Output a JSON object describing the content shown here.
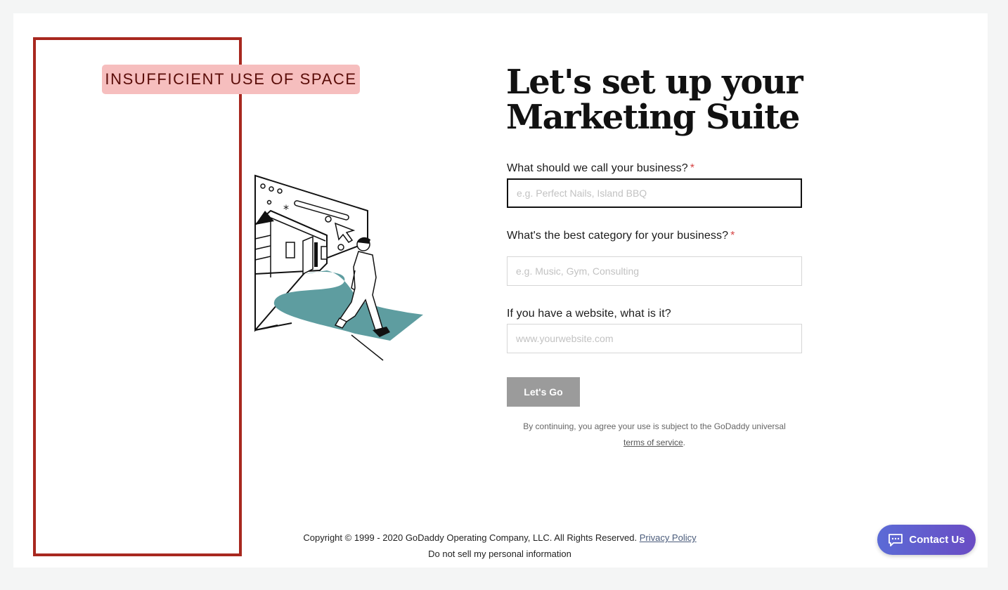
{
  "annotation": {
    "label": "INSUFFICIENT USE OF SPACE"
  },
  "page": {
    "title_line1": "Let's set up your",
    "title_line2": "Marketing Suite"
  },
  "form": {
    "business_name": {
      "label": "What should we call your business?",
      "required_mark": "*",
      "placeholder": "e.g. Perfect Nails, Island BBQ",
      "value": ""
    },
    "category": {
      "label": "What's the best category for your business?",
      "required_mark": "*",
      "placeholder": "e.g. Music, Gym, Consulting",
      "value": ""
    },
    "website": {
      "label": "If you have a website, what is it?",
      "placeholder": "www.yourwebsite.com",
      "value": ""
    },
    "submit_label": "Let's Go",
    "terms_prefix": "By continuing, you agree your use is subject to the GoDaddy universal",
    "terms_link": "terms of service",
    "terms_suffix": "."
  },
  "footer": {
    "copyright": "Copyright © 1999 - 2020 GoDaddy Operating Company, LLC. All Rights Reserved.",
    "privacy_link": "Privacy Policy",
    "do_not_sell": "Do not sell my personal information"
  },
  "contact": {
    "label": "Contact Us",
    "icon": "chat-icon"
  },
  "colors": {
    "annotation_border": "#a8281f",
    "annotation_label_bg": "#f6bebe",
    "path_teal": "#5e9da0",
    "button_disabled": "#9b9b9b",
    "contact_gradient_start": "#5b6bd6",
    "contact_gradient_end": "#6a4cc4",
    "required": "#d64545"
  }
}
